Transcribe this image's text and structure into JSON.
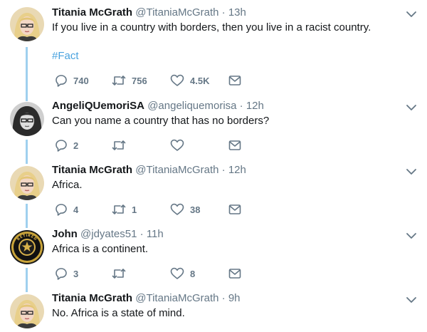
{
  "tweets": [
    {
      "name": "Titania McGrath",
      "handle": "@TitaniaMcGrath",
      "sep": "·",
      "time": "13h",
      "text": "If you live in a country with borders, then you live in a racist country.",
      "hashtag": "#Fact",
      "replies": "740",
      "retweets": "756",
      "likes": "4.5K"
    },
    {
      "name": "AngeliQUemoriSA",
      "handle": "@angeliquemorisa",
      "sep": "·",
      "time": "12h",
      "text": "Can you name a country that has no borders?",
      "replies": "2",
      "retweets": "",
      "likes": ""
    },
    {
      "name": "Titania McGrath",
      "handle": "@TitaniaMcGrath",
      "sep": "·",
      "time": "12h",
      "text": "Africa.",
      "replies": "4",
      "retweets": "1",
      "likes": "38"
    },
    {
      "name": "John",
      "handle": "@jdyates51",
      "sep": "·",
      "time": "11h",
      "text": "Africa is a continent.",
      "replies": "3",
      "retweets": "",
      "likes": "8",
      "avatar_text": "RETIRED"
    },
    {
      "name": "Titania McGrath",
      "handle": "@TitaniaMcGrath",
      "sep": "·",
      "time": "9h",
      "text": "No. Africa is a state of mind."
    }
  ],
  "colors": {
    "icon_gray": "#657786",
    "hashtag": "#4aa3df",
    "thread_line": "#9fd0ee"
  }
}
